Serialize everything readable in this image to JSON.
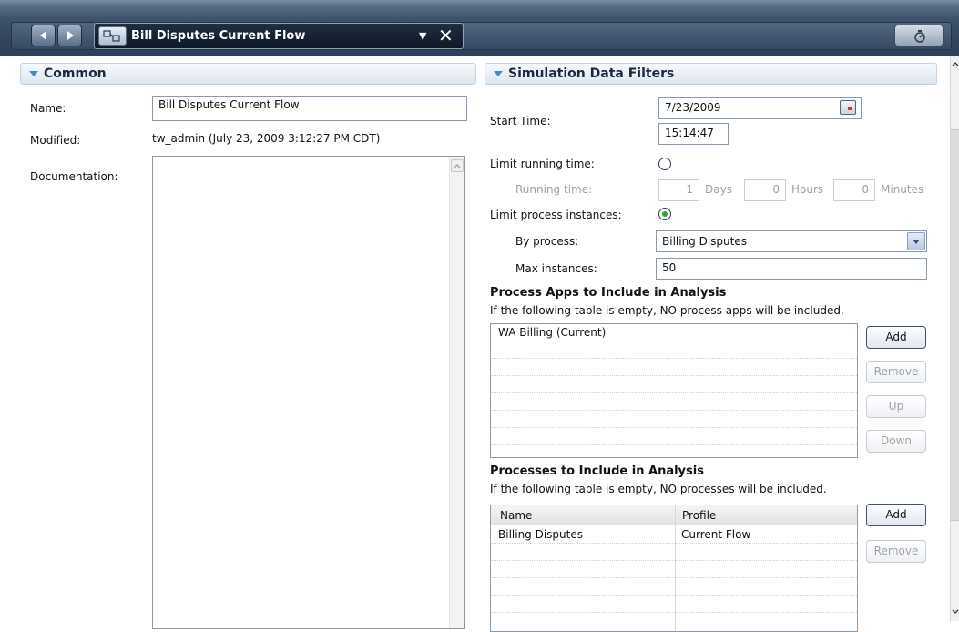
{
  "toolbar": {
    "tab_title": "Bill Disputes Current Flow",
    "icons": [
      "back-arrow-icon",
      "forward-arrow-icon",
      "process-diagram-icon",
      "dropdown-icon",
      "close-icon",
      "run-simulation-icon"
    ]
  },
  "common": {
    "header": "Common",
    "name_label": "Name:",
    "name_value": "Bill Disputes Current Flow",
    "modified_label": "Modified:",
    "modified_value": "tw_admin (July 23, 2009 3:12:27 PM CDT)",
    "documentation_label": "Documentation:"
  },
  "filters": {
    "header": "Simulation Data Filters",
    "start_time_label": "Start Time:",
    "start_date": "7/23/2009",
    "start_time": "15:14:47",
    "limit_running_label": "Limit running time:",
    "running_time_label": "Running time:",
    "days_value": "1",
    "days_label": "Days",
    "hours_value": "0",
    "hours_label": "Hours",
    "minutes_value": "0",
    "minutes_label": "Minutes",
    "limit_instances_label": "Limit process instances:",
    "by_process_label": "By process:",
    "by_process_value": "Billing Disputes",
    "max_instances_label": "Max instances:",
    "max_instances_value": "50"
  },
  "apps": {
    "title": "Process Apps to Include in Analysis",
    "note": "If the following table is empty, NO process apps will be included.",
    "rows": [
      "WA Billing (Current)"
    ],
    "add": "Add",
    "remove": "Remove",
    "up": "Up",
    "down": "Down"
  },
  "processes": {
    "title": "Processes to Include in Analysis",
    "note": "If the following table is empty, NO processes will be included.",
    "col_name": "Name",
    "col_profile": "Profile",
    "rows": [
      {
        "name": "Billing Disputes",
        "profile": "Current Flow"
      }
    ],
    "add": "Add",
    "remove": "Remove"
  }
}
